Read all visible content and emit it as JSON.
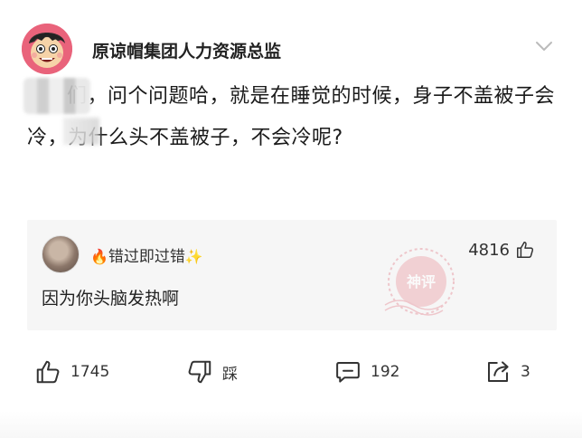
{
  "post": {
    "author_name": "原谅帽集团人力资源总监",
    "body_text": "们，问个问题哈，就是在睡觉的时候，身子不盖被子会冷，为什么头不盖被子，不会冷呢?"
  },
  "hot_comment": {
    "user_prefix_emoji": "🔥",
    "user_name": "错过即过错",
    "user_suffix_emoji": "✨",
    "text": "因为你头脑发热啊",
    "like_count": "4816",
    "stamp_text": "神评"
  },
  "actions": {
    "like_count": "1745",
    "dislike_label": "踩",
    "comment_count": "192",
    "share_count": "3"
  },
  "colors": {
    "accent_stamp": "#e8a0a8",
    "avatar_bg": "#e9637b",
    "comment_bg": "#f6f6f6"
  }
}
